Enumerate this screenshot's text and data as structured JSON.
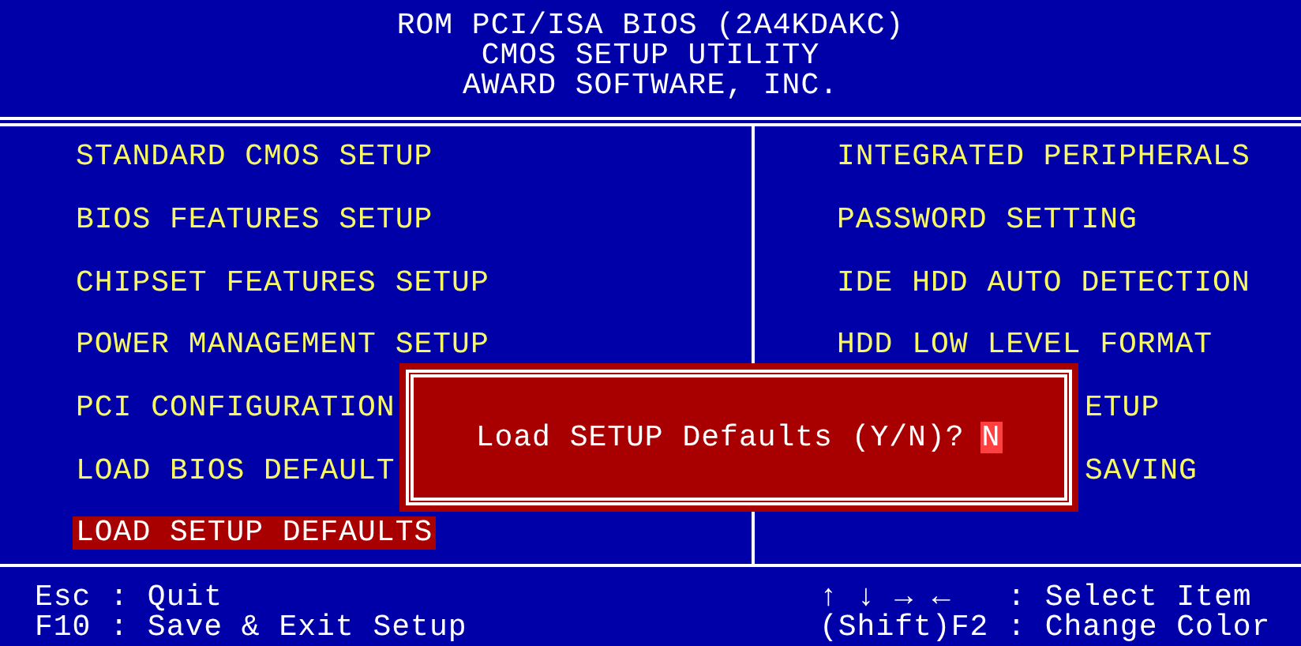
{
  "header": [
    "ROM PCI/ISA BIOS (2A4KDAKC)",
    "CMOS SETUP UTILITY",
    "AWARD SOFTWARE, INC."
  ],
  "left_menu": [
    {
      "label": "STANDARD CMOS SETUP",
      "selected": false
    },
    {
      "label": "BIOS FEATURES SETUP",
      "selected": false
    },
    {
      "label": "CHIPSET FEATURES SETUP",
      "selected": false
    },
    {
      "label": "POWER MANAGEMENT SETUP",
      "selected": false
    },
    {
      "label": "PCI CONFIGURATION",
      "selected": false
    },
    {
      "label": "LOAD BIOS DEFAULT",
      "selected": false
    },
    {
      "label": "LOAD SETUP DEFAULTS",
      "selected": true
    }
  ],
  "right_menu": [
    {
      "label": "INTEGRATED PERIPHERALS",
      "selected": false,
      "kind": "full"
    },
    {
      "label": "PASSWORD SETTING",
      "selected": false,
      "kind": "full"
    },
    {
      "label": "IDE HDD AUTO DETECTION",
      "selected": false,
      "kind": "full"
    },
    {
      "label": "HDD LOW LEVEL FORMAT",
      "selected": false,
      "kind": "full"
    },
    {
      "label": "ETUP",
      "selected": false,
      "kind": "covered"
    },
    {
      "label": "SAVING",
      "selected": false,
      "kind": "covered"
    }
  ],
  "dialog": {
    "prompt": "Load SETUP Defaults (Y/N)?",
    "answer": "N"
  },
  "footer_left": [
    "Esc : Quit",
    "F10 : Save & Exit Setup"
  ],
  "footer_right": [
    "↑ ↓ → ←   : Select Item",
    "(Shift)F2 : Change Color"
  ]
}
